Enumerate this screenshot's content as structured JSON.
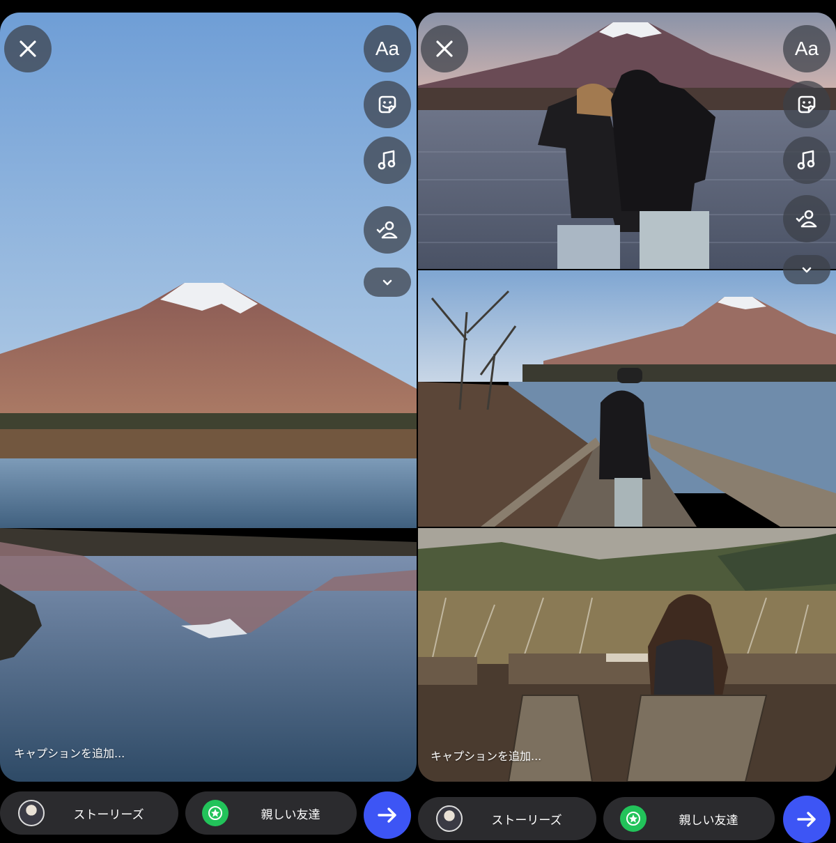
{
  "left": {
    "caption_placeholder": "キャプションを追加...",
    "tools": {
      "text_label": "Aa"
    }
  },
  "right": {
    "caption_placeholder": "キャプションを追加...",
    "tools": {
      "text_label": "Aa"
    }
  },
  "bottom_left": {
    "stories_label": "ストーリーズ",
    "close_friends_label": "親しい友達"
  },
  "bottom_right": {
    "stories_label": "ストーリーズ",
    "close_friends_label": "親しい友達"
  },
  "icons": {
    "close": "close-icon",
    "text": "text-tool-icon",
    "sticker": "sticker-icon",
    "music": "music-icon",
    "tag": "tag-people-icon",
    "more": "chevron-down-icon",
    "star": "star-icon",
    "send": "arrow-right-icon"
  },
  "colors": {
    "send_button": "#3d55f5",
    "close_friends_badge": "#22c35a",
    "pill_bg": "#2b2b2e"
  }
}
